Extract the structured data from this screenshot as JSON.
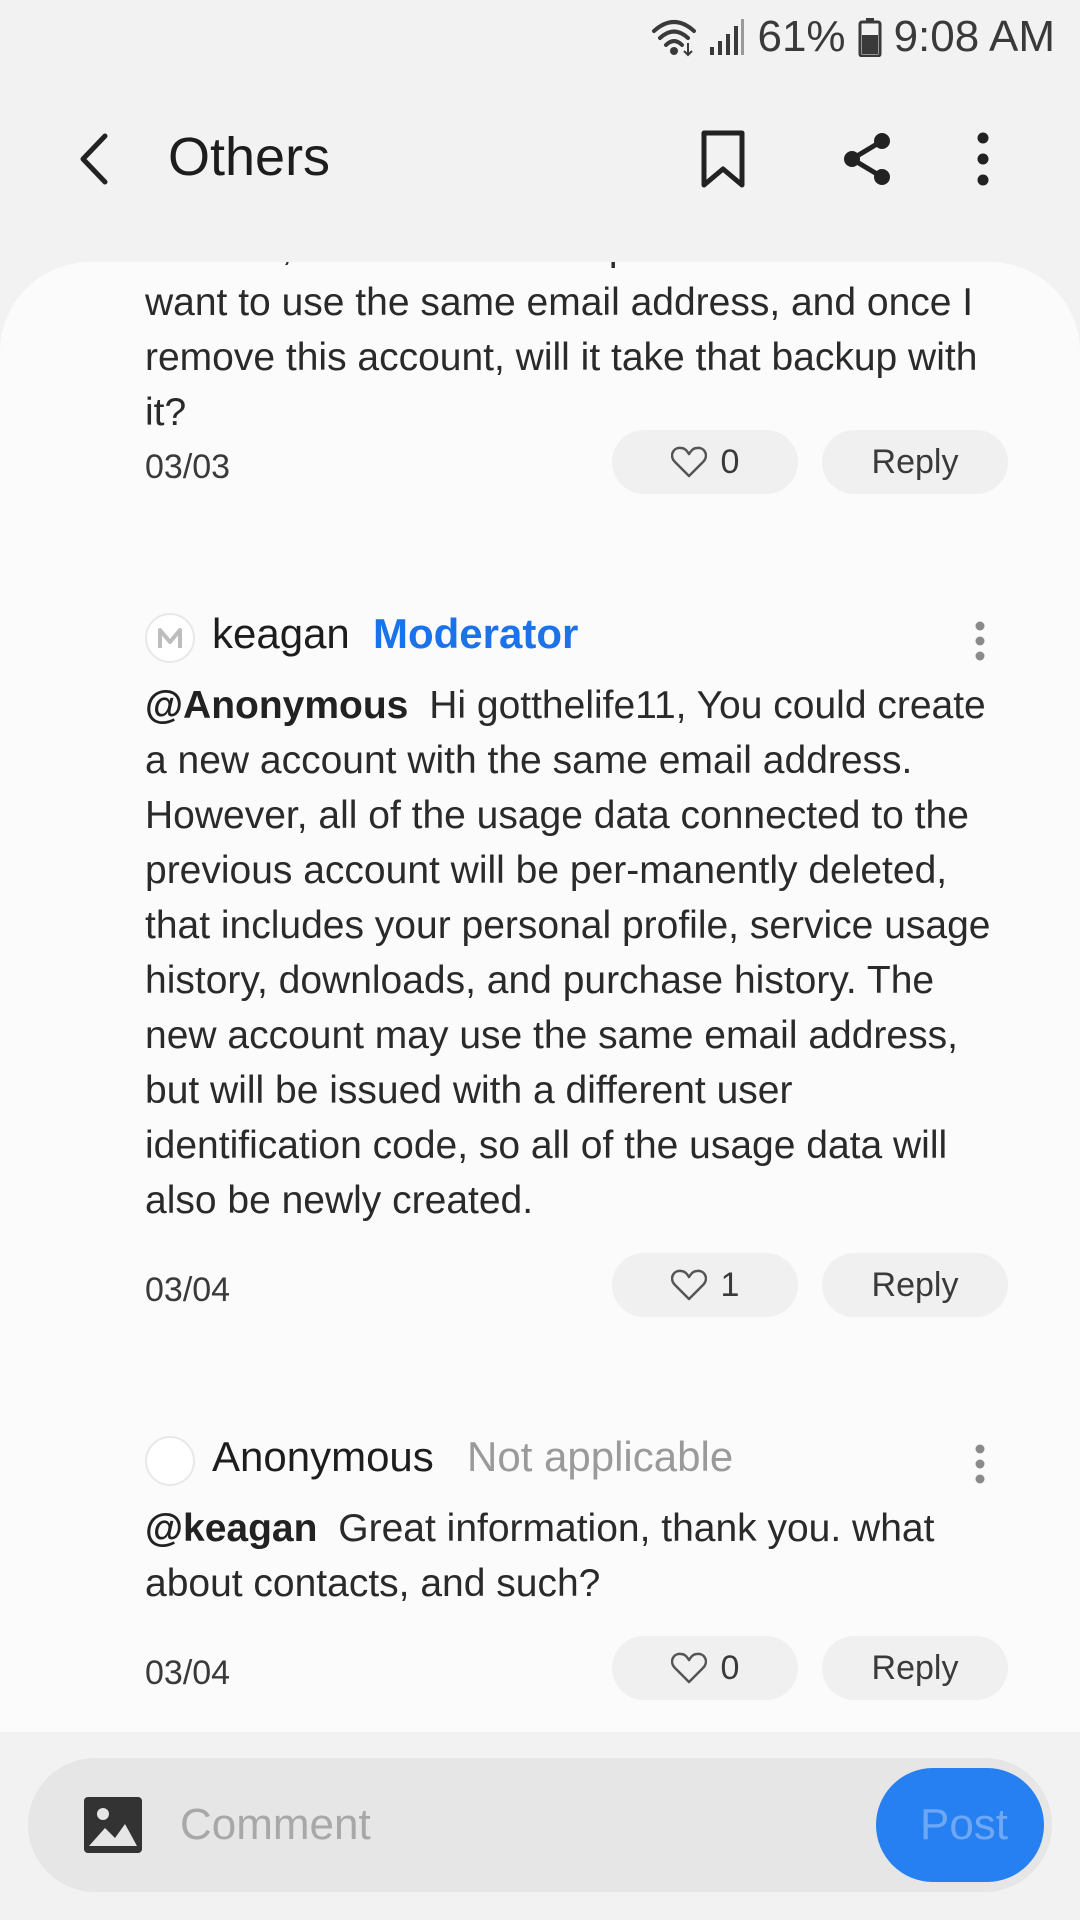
{
  "status_bar": {
    "battery_percent": "61%",
    "time": "9:08 AM",
    "icons": [
      "wifi-icon",
      "signal-icon",
      "battery-icon"
    ]
  },
  "app_bar": {
    "title": "Others",
    "icons": [
      "back-arrow-icon",
      "bookmark-icon",
      "share-icon",
      "more-vertical-icon"
    ]
  },
  "comments": [
    {
      "partial_text": "account, or will that not be possible because I want to use the same email address, and once I remove this account, will it take that backup with it?",
      "date": "03/03",
      "likes": "0",
      "reply_label": "Reply"
    },
    {
      "author": "keagan",
      "role": "Moderator",
      "mention": "@Anonymous",
      "text": "Hi gotthelife11, You could create a new account with the same email address. However, all of the usage data connected to the previous account will be per-manently deleted, that includes your personal profile, service usage history, downloads, and purchase history. The new account may use the same email address, but will be issued with a different user identification code, so all of the usage data will also be newly created.",
      "date": "03/04",
      "likes": "1",
      "reply_label": "Reply"
    },
    {
      "author": "Anonymous",
      "role": "Not applicable",
      "mention": "@keagan",
      "text": "Great information, thank you. what about contacts, and such?",
      "date": "03/04",
      "likes": "0",
      "reply_label": "Reply"
    }
  ],
  "comment_bar": {
    "placeholder": "Comment",
    "post_label": "Post"
  },
  "colors": {
    "accent": "#2780f1",
    "moderator": "#1a73e8",
    "background": "#f2f2f2",
    "card": "#fbfbfb"
  }
}
